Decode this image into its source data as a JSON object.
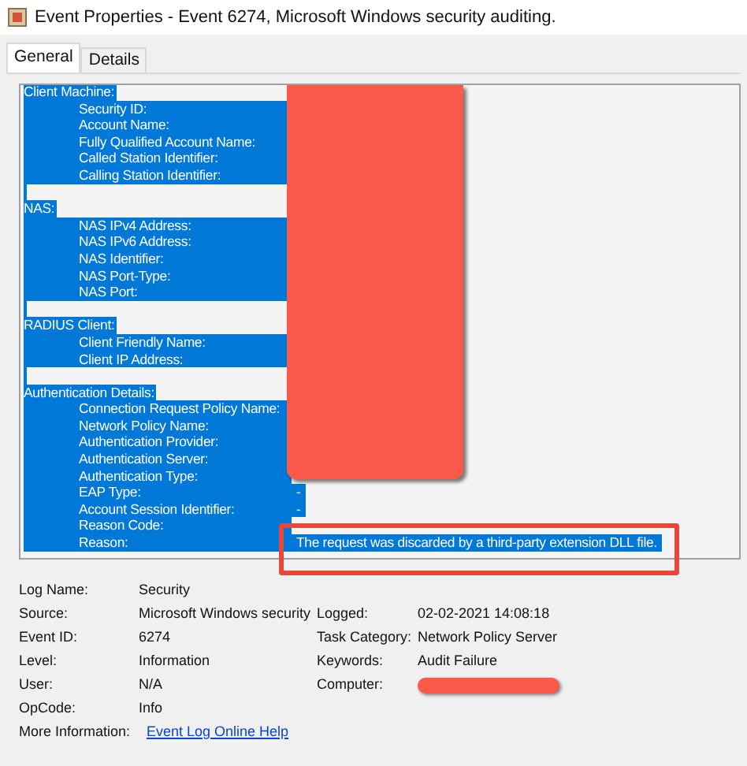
{
  "window": {
    "title": "Event Properties - Event 6274, Microsoft Windows security auditing."
  },
  "tabs": [
    {
      "label": "General",
      "selected": true
    },
    {
      "label": "Details",
      "selected": false
    }
  ],
  "description": {
    "selected": true,
    "lines": [
      {
        "kind": "header",
        "text": "Client Machine:"
      },
      {
        "kind": "field",
        "label": "Security ID:"
      },
      {
        "kind": "field",
        "label": "Account Name:"
      },
      {
        "kind": "field",
        "label": "Fully Qualified Account Name:"
      },
      {
        "kind": "field",
        "label": "Called Station Identifier:"
      },
      {
        "kind": "field",
        "label": "Calling Station Identifier:"
      },
      {
        "kind": "blank"
      },
      {
        "kind": "header",
        "text": "NAS:"
      },
      {
        "kind": "field",
        "label": "NAS IPv4 Address:"
      },
      {
        "kind": "field",
        "label": "NAS IPv6 Address:"
      },
      {
        "kind": "field",
        "label": "NAS Identifier:"
      },
      {
        "kind": "field",
        "label": "NAS Port-Type:"
      },
      {
        "kind": "field",
        "label": "NAS Port:"
      },
      {
        "kind": "blank"
      },
      {
        "kind": "header",
        "text": "RADIUS Client:"
      },
      {
        "kind": "field",
        "label": "Client Friendly Name:"
      },
      {
        "kind": "field",
        "label": "Client IP Address:"
      },
      {
        "kind": "blank"
      },
      {
        "kind": "header",
        "text": "Authentication Details:"
      },
      {
        "kind": "field",
        "label": "Connection Request Policy Name:"
      },
      {
        "kind": "field",
        "label": "Network Policy Name:"
      },
      {
        "kind": "field",
        "label": "Authentication Provider:"
      },
      {
        "kind": "field",
        "label": "Authentication Server:"
      },
      {
        "kind": "field",
        "label": "Authentication Type:"
      },
      {
        "kind": "field",
        "label": "EAP Type:",
        "value": "-"
      },
      {
        "kind": "field",
        "label": "Account Session Identifier:",
        "value": "-"
      },
      {
        "kind": "field",
        "label": "Reason Code:"
      },
      {
        "kind": "field",
        "label": "Reason:",
        "value": "The request was discarded by a third-party extension DLL file."
      }
    ]
  },
  "properties": [
    {
      "label": "Log Name:",
      "value": "Security"
    },
    {
      "label": "Source:",
      "value": "Microsoft Windows security",
      "label_2": "Logged:",
      "value_2": "02-02-2021 14:08:18"
    },
    {
      "label": "Event ID:",
      "value": "6274",
      "label_2": "Task Category:",
      "value_2": "Network Policy Server"
    },
    {
      "label": "Level:",
      "value": "Information",
      "label_2": "Keywords:",
      "value_2": "Audit Failure"
    },
    {
      "label": "User:",
      "value": "N/A",
      "label_2": "Computer:"
    },
    {
      "label": "OpCode:",
      "value": "Info"
    },
    {
      "label": "More Information:",
      "link": "Event Log Online Help"
    }
  ]
}
